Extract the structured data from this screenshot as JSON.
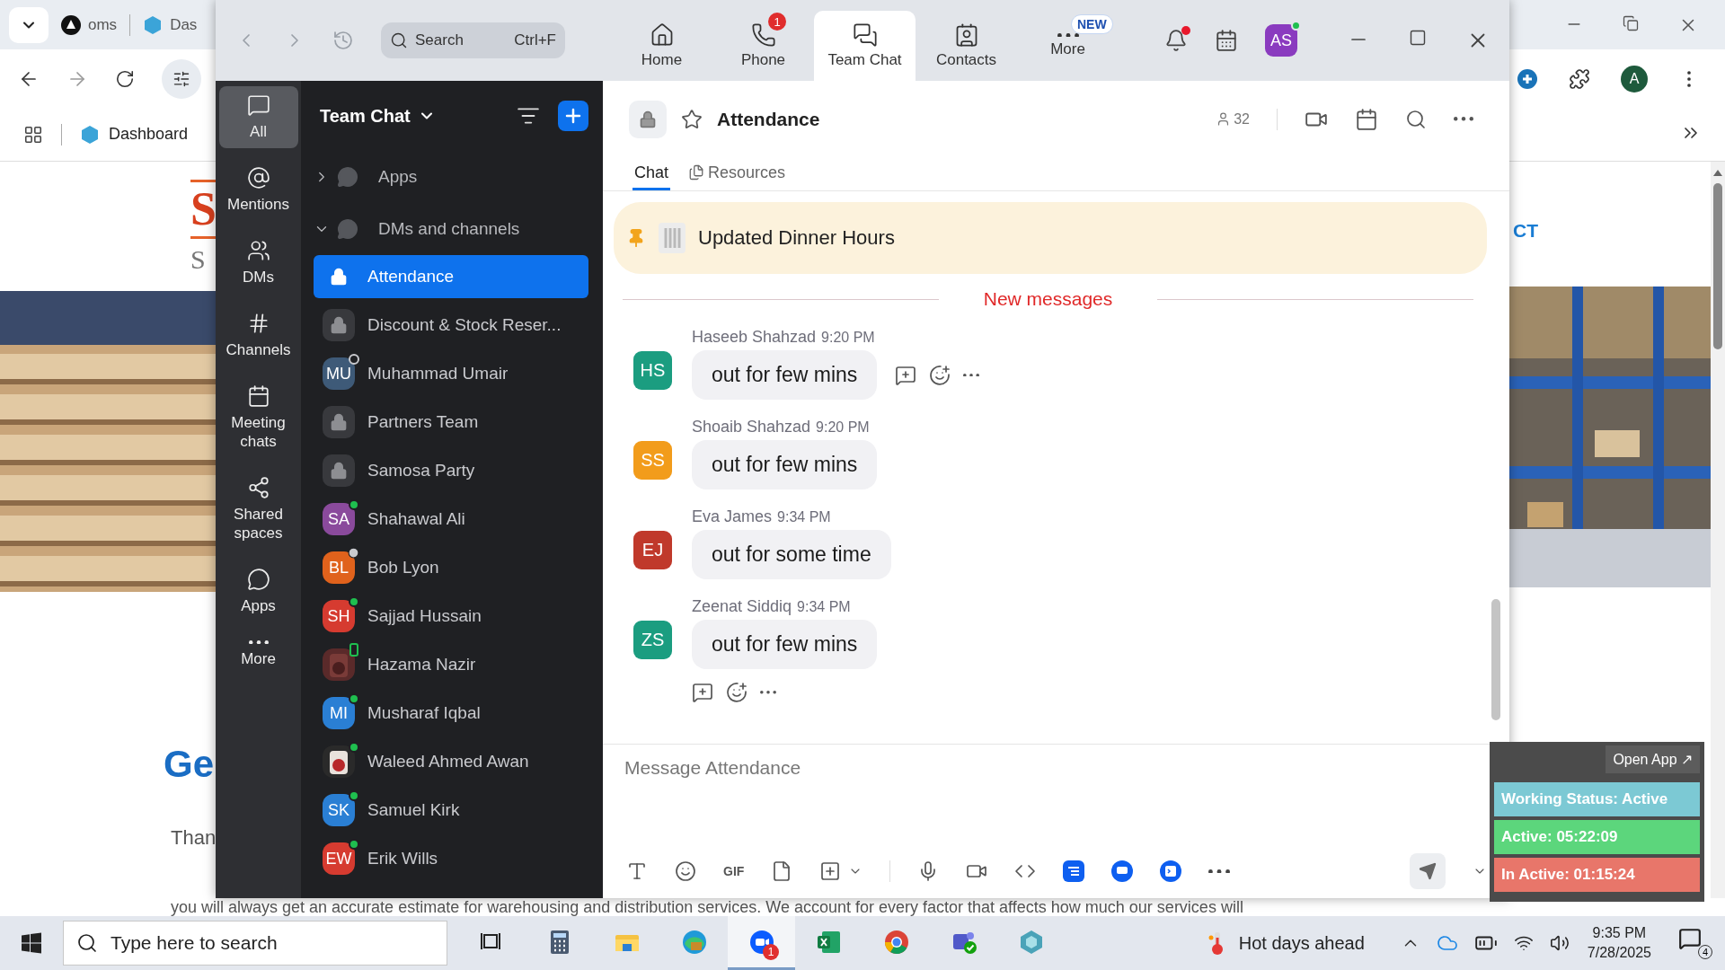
{
  "browser": {
    "tabs": [
      {
        "label": "oms"
      },
      {
        "label": "Das"
      }
    ],
    "bookmarks": [
      {
        "label": "Dashboard"
      }
    ],
    "profile": "A",
    "page": {
      "logo": "S",
      "logo_sub": "S",
      "heading": "Ge",
      "paragraph": "Than",
      "link": "CT",
      "bottom_text": "you will always get an accurate estimate for warehousing and distribution services. We account for every factor that affects how much our services will"
    }
  },
  "window": {
    "search": {
      "placeholder": "Search",
      "shortcut": "Ctrl+F"
    },
    "nav": [
      {
        "label": "Home",
        "kind": "home",
        "selected": false
      },
      {
        "label": "Phone",
        "kind": "phone",
        "selected": false,
        "badge": "1"
      },
      {
        "label": "Team Chat",
        "kind": "chat",
        "selected": true
      },
      {
        "label": "Contacts",
        "kind": "contacts",
        "selected": false
      },
      {
        "label": "More",
        "kind": "more",
        "selected": false,
        "tag": "NEW"
      }
    ],
    "avatar": "AS"
  },
  "rail": [
    {
      "label": "All",
      "kind": "all",
      "selected": true
    },
    {
      "label": "Mentions",
      "kind": "mentions",
      "selected": false
    },
    {
      "label": "DMs",
      "kind": "dms",
      "selected": false
    },
    {
      "label": "Channels",
      "kind": "channels",
      "selected": false
    },
    {
      "label": "Meeting chats",
      "kind": "meetings",
      "selected": false
    },
    {
      "label": "Shared spaces",
      "kind": "shared",
      "selected": false
    },
    {
      "label": "Apps",
      "kind": "apps",
      "selected": false
    },
    {
      "label": "More",
      "kind": "more",
      "selected": false
    }
  ],
  "list": {
    "title": "Team Chat",
    "sections": [
      {
        "label": "Apps",
        "expanded": false
      },
      {
        "label": "DMs and channels",
        "expanded": true
      }
    ],
    "items": [
      {
        "kind": "channel",
        "name": "Attendance",
        "selected": true
      },
      {
        "kind": "channel",
        "name": "Discount & Stock Reser...",
        "selected": false
      },
      {
        "kind": "dm",
        "initials": "MU",
        "color": "#3e5a78",
        "name": "Muhammad Umair",
        "presence": {
          "kind": "offline"
        },
        "selected": false
      },
      {
        "kind": "channel",
        "name": "Partners Team",
        "selected": false
      },
      {
        "kind": "channel",
        "name": "Samosa Party",
        "selected": false
      },
      {
        "kind": "dm",
        "initials": "SA",
        "color": "#8a4a9c",
        "name": "Shahawal Ali",
        "presence": {
          "kind": "online"
        },
        "selected": false
      },
      {
        "kind": "dm",
        "initials": "BL",
        "color": "#e0621c",
        "name": "Bob Lyon",
        "presence": {
          "kind": "away"
        },
        "selected": false
      },
      {
        "kind": "dm",
        "initials": "SH",
        "color": "#d63b30",
        "name": "Sajjad Hussain",
        "presence": {
          "kind": "online"
        },
        "selected": false
      },
      {
        "name": "Hazama Nazir",
        "presence": {
          "kind": "mobile"
        },
        "selected": false
      },
      {
        "kind": "dm",
        "initials": "MI",
        "color": "#2a7fd4",
        "name": "Musharaf Iqbal",
        "presence": {
          "kind": "online"
        },
        "selected": false
      },
      {
        "name": "Waleed Ahmed Awan",
        "presence": {
          "kind": "online"
        },
        "selected": false
      },
      {
        "kind": "dm",
        "initials": "SK",
        "color": "#2a7fd4",
        "name": "Samuel Kirk",
        "presence": {
          "kind": "online"
        },
        "selected": false
      },
      {
        "kind": "dm",
        "initials": "EW",
        "color": "#d63b30",
        "name": "Erik Wills",
        "presence": {
          "kind": "online"
        },
        "selected": false
      }
    ]
  },
  "chat": {
    "title": "Attendance",
    "members": "32",
    "tabs": [
      {
        "label": "Chat",
        "selected": true
      },
      {
        "label": "Resources",
        "selected": false
      }
    ],
    "pinned": "Updated Dinner Hours",
    "divider": "New messages",
    "messages": [
      {
        "sender": "Haseeb Shahzad",
        "time": "9:20 PM",
        "initials": "HS",
        "color": "#1b9d80",
        "text": "out for few mins",
        "actions": {
          "kind": "side"
        }
      },
      {
        "sender": "Shoaib Shahzad",
        "time": "9:20 PM",
        "initials": "SS",
        "color": "#f29c1b",
        "text": "out for few mins"
      },
      {
        "sender": "Eva James",
        "time": "9:34 PM",
        "initials": "EJ",
        "color": "#c0392b",
        "text": "out for some time"
      },
      {
        "sender": "Zeenat Siddiq",
        "time": "9:34 PM",
        "initials": "ZS",
        "color": "#1b9d80",
        "text": "out for few mins",
        "actions": {
          "kind": "below"
        }
      }
    ],
    "composer": {
      "placeholder": "Message Attendance",
      "gif": "GIF"
    }
  },
  "widget": {
    "button": "Open App ↗",
    "rows": [
      {
        "text": "Working Status: Active",
        "color": "#7cc9d4"
      },
      {
        "text": "Active: 05:22:09",
        "color": "#5cd67c"
      },
      {
        "text": "In Active: 01:15:24",
        "color": "#e8766a"
      }
    ]
  },
  "taskbar": {
    "search": {
      "placeholder": "Type here to search"
    },
    "zoom_badge": "1",
    "weather": "Hot days ahead",
    "time": "9:35 PM",
    "date": "7/28/2025",
    "notifications": "4"
  }
}
